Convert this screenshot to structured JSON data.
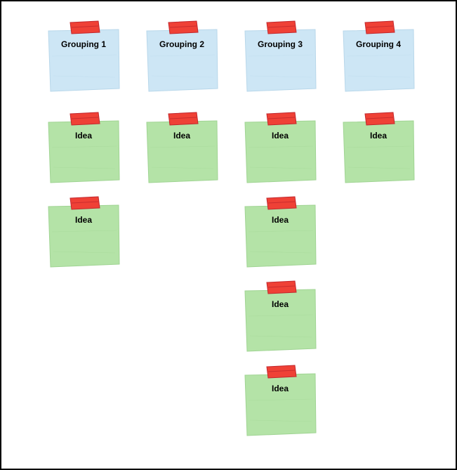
{
  "colors": {
    "blue_fill": "#cde6f5",
    "blue_stroke": "#b8d7ea",
    "green_fill": "#b4e3a7",
    "green_stroke": "#a0d493",
    "tape_fill": "#ef4136",
    "tape_stroke": "#c1272d"
  },
  "layout": {
    "col_x": [
      64,
      204,
      344,
      484
    ],
    "row_y": [
      40,
      170,
      290,
      410,
      530
    ],
    "note_w": 106,
    "note_h": 90
  },
  "notes": [
    {
      "id": "grouping-1",
      "label": "Grouping 1",
      "color": "blue",
      "col": 0,
      "row": 0
    },
    {
      "id": "grouping-2",
      "label": "Grouping 2",
      "color": "blue",
      "col": 1,
      "row": 0
    },
    {
      "id": "grouping-3",
      "label": "Grouping 3",
      "color": "blue",
      "col": 2,
      "row": 0
    },
    {
      "id": "grouping-4",
      "label": "Grouping 4",
      "color": "blue",
      "col": 3,
      "row": 0
    },
    {
      "id": "idea-1-1",
      "label": "Idea",
      "color": "green",
      "col": 0,
      "row": 1
    },
    {
      "id": "idea-2-1",
      "label": "Idea",
      "color": "green",
      "col": 1,
      "row": 1
    },
    {
      "id": "idea-3-1",
      "label": "Idea",
      "color": "green",
      "col": 2,
      "row": 1
    },
    {
      "id": "idea-4-1",
      "label": "Idea",
      "color": "green",
      "col": 3,
      "row": 1
    },
    {
      "id": "idea-1-2",
      "label": "Idea",
      "color": "green",
      "col": 0,
      "row": 2
    },
    {
      "id": "idea-3-2",
      "label": "Idea",
      "color": "green",
      "col": 2,
      "row": 2
    },
    {
      "id": "idea-3-3",
      "label": "Idea",
      "color": "green",
      "col": 2,
      "row": 3
    },
    {
      "id": "idea-3-4",
      "label": "Idea",
      "color": "green",
      "col": 2,
      "row": 4
    }
  ]
}
